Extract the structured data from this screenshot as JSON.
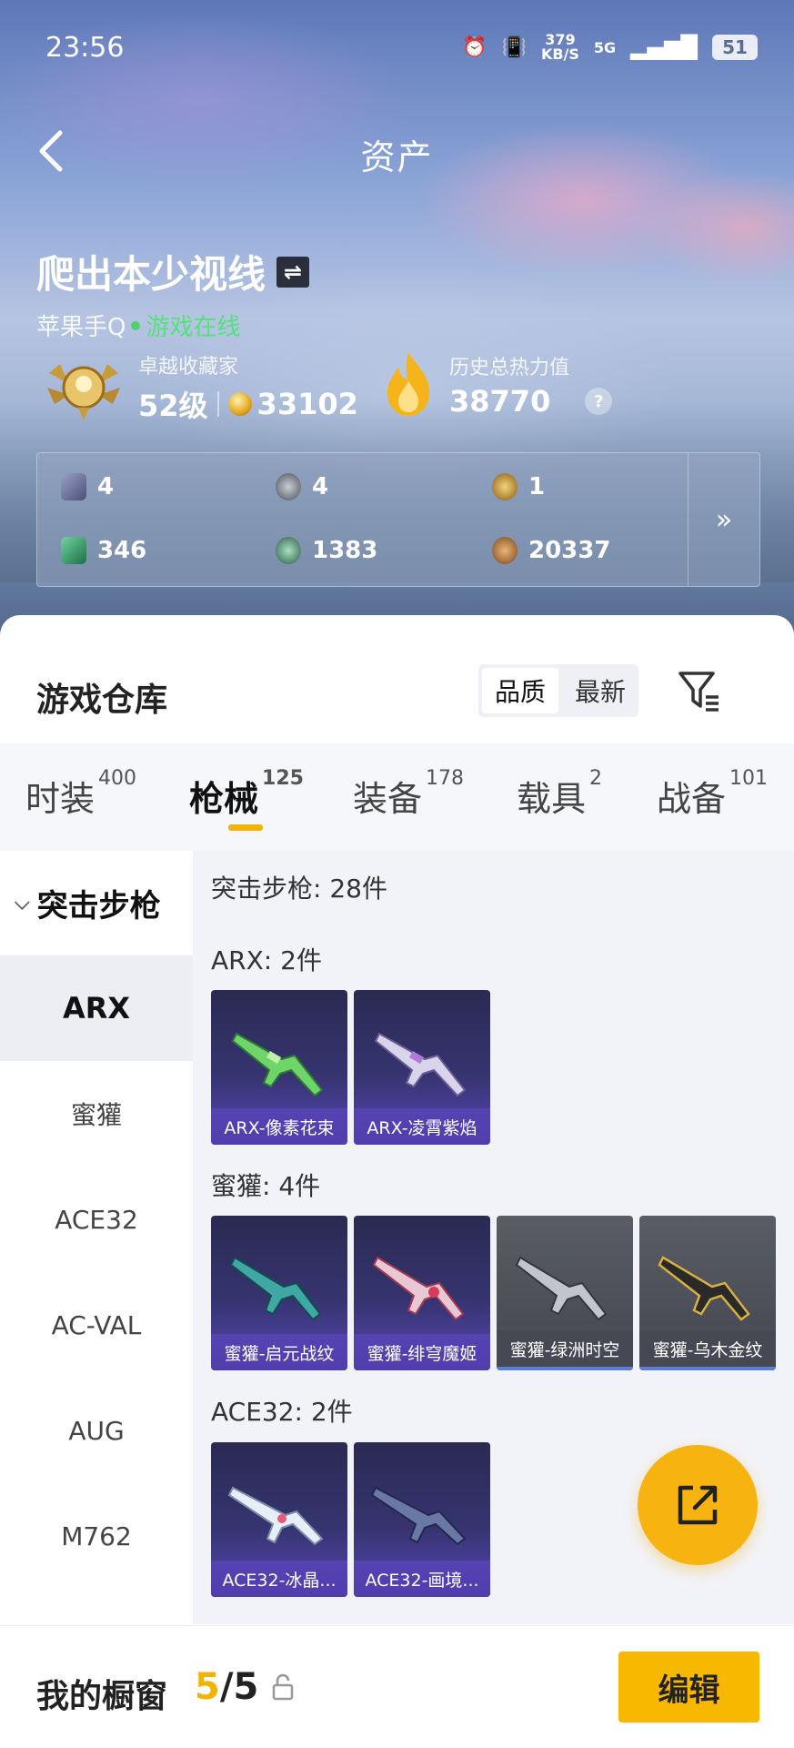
{
  "status_bar": {
    "time": "23:56",
    "net_speed": "379",
    "net_unit": "KB/S",
    "network": "5G",
    "battery": "51"
  },
  "nav": {
    "title": "资产"
  },
  "profile": {
    "name": "爬出本少视线",
    "platform": "苹果手Q",
    "status": "游戏在线"
  },
  "collector": {
    "label": "卓越收藏家",
    "level": "52级",
    "coins": "33102"
  },
  "heat": {
    "label": "历史总热力值",
    "value": "38770",
    "help": "?"
  },
  "resources": [
    {
      "icon": "card-icon",
      "value": "4",
      "color": "#6a6f9a"
    },
    {
      "icon": "badge-icon",
      "value": "4",
      "color": "#8a8f99"
    },
    {
      "icon": "emblem-icon",
      "value": "1",
      "color": "#c9962e"
    },
    {
      "icon": "ticket-icon",
      "value": "346",
      "color": "#2f9c6a"
    },
    {
      "icon": "orb-icon",
      "value": "1383",
      "color": "#4b8a6a"
    },
    {
      "icon": "shell-icon",
      "value": "20337",
      "color": "#b0793a"
    }
  ],
  "warehouse": {
    "title": "游戏仓库",
    "sort": [
      "品质",
      "最新"
    ],
    "tabs": [
      {
        "label": "时装",
        "count": "400"
      },
      {
        "label": "枪械",
        "count": "125"
      },
      {
        "label": "装备",
        "count": "178"
      },
      {
        "label": "载具",
        "count": "2"
      },
      {
        "label": "战备",
        "count": "101"
      }
    ],
    "category": "突击步枪",
    "sidebar": [
      "ARX",
      "蜜獾",
      "ACE32",
      "AC-VAL",
      "AUG",
      "M762"
    ],
    "summary": "突击步枪: 28件",
    "groups": [
      {
        "label": "ARX: 2件",
        "items": [
          "ARX-像素花束",
          "ARX-凌霄紫焰"
        ]
      },
      {
        "label": "蜜獾: 4件",
        "items": [
          "蜜獾-启元战纹",
          "蜜獾-绯穹魔姬",
          "蜜獾-绿洲时空",
          "蜜獾-乌木金纹"
        ]
      },
      {
        "label": "ACE32: 2件",
        "items": [
          "ACE32-冰晶...",
          "ACE32-画境..."
        ]
      }
    ]
  },
  "showcase": {
    "label": "我的橱窗",
    "current": "5",
    "total": "/5",
    "edit": "编辑"
  },
  "colors": {
    "accent": "#f6b400",
    "online": "#4fd26a",
    "card_purple": "#5845b8"
  }
}
